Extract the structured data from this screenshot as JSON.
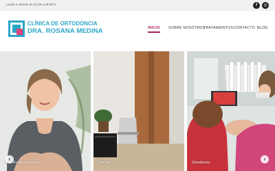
{
  "topbar": {
    "hours": "Lunes a viernes de 11:00 a 19:00 h.",
    "social_icons": [
      "facebook-icon",
      "instagram-icon"
    ]
  },
  "logo": {
    "line1": "CLÍNICA DE ORTODONCIA",
    "line2": "DRA. ROSANA MEDINA",
    "colors": {
      "blue": "#2aa6c7",
      "pink": "#e0457b"
    }
  },
  "nav": {
    "items": [
      {
        "label": "INICIO",
        "active": true
      },
      {
        "label": "SOBRE NOSOTROS",
        "active": false
      },
      {
        "label": "TRATAMIENTOS",
        "active": false
      },
      {
        "label": "CONTACTO",
        "active": false
      },
      {
        "label": "BLOG",
        "active": false
      }
    ],
    "active_color": "#a4225c"
  },
  "gallery": {
    "panels": [
      {
        "caption": "Dra. Rosana Medina"
      },
      {
        "caption": "Oficina"
      },
      {
        "caption": "Ortodoncia"
      }
    ],
    "prev_icon": "chevron-left-icon",
    "next_icon": "chevron-right-icon"
  }
}
